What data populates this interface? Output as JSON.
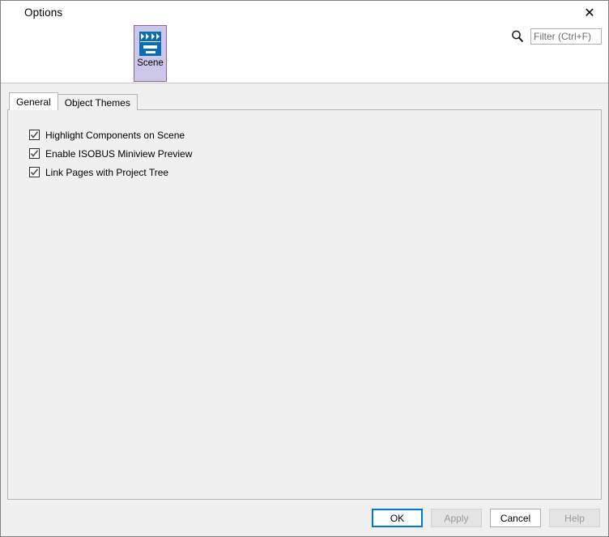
{
  "window": {
    "title": "Options",
    "close_label": "✕"
  },
  "toolbar": {
    "category": {
      "label": "Scene",
      "icon": "scene-icon",
      "selected": true,
      "border_color": "#8b63ab",
      "fill_color": "#ccc6e8",
      "icon_color": "#0a6cb4"
    },
    "search": {
      "icon": "search-icon",
      "placeholder": "Filter (Ctrl+F)",
      "value": ""
    }
  },
  "tabs": [
    {
      "label": "General",
      "selected": true
    },
    {
      "label": "Object Themes",
      "selected": false
    }
  ],
  "general": {
    "options": [
      {
        "label": "Highlight Components on Scene",
        "checked": true
      },
      {
        "label": "Enable ISOBUS Miniview Preview",
        "checked": true
      },
      {
        "label": "Link Pages with Project Tree",
        "checked": true
      }
    ]
  },
  "buttons": [
    {
      "label": "OK",
      "state": "default"
    },
    {
      "label": "Apply",
      "state": "disabled"
    },
    {
      "label": "Cancel",
      "state": "normal"
    },
    {
      "label": "Help",
      "state": "disabled"
    }
  ],
  "colors": {
    "accent": "#0078d7",
    "dialog_bg": "#f0f0f0",
    "panel_bg": "#ffffff"
  }
}
